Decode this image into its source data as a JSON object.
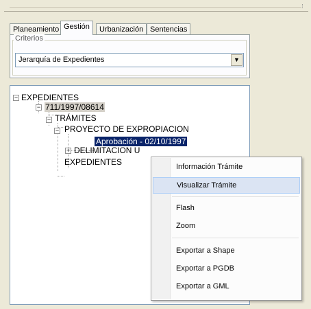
{
  "tabs": [
    "Planeamiento",
    "Gestión",
    "Urbanización",
    "Sentencias"
  ],
  "active_tab": "Gestión",
  "criterios": {
    "legend": "Criterios",
    "combo_value": "Jerarquía de Expedientes"
  },
  "tree": {
    "root": "EXPEDIENTES",
    "expediente": "711/1997/08614",
    "tramites": "TRÁMITES",
    "proyecto": "PROYECTO DE EXPROPIACION",
    "aprobacion": "Aprobación - 02/10/1997",
    "delimitacion": "DELIMITACION U",
    "expedientes_child": "EXPEDIENTES"
  },
  "context_menu": {
    "items": [
      "Información Trámite",
      "Visualizar Trámite",
      "Flash",
      "Zoom",
      "Exportar a Shape",
      "Exportar a PGDB",
      "Exportar a GML"
    ],
    "highlighted": "Visualizar Trámite"
  },
  "icons": {
    "expand": "plus-box-icon",
    "collapse": "minus-box-icon",
    "dropdown": "chevron-down-icon"
  }
}
